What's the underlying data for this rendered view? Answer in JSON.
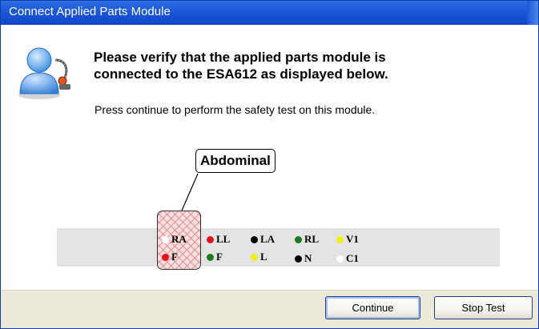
{
  "window": {
    "title": "Connect Applied Parts Module",
    "icon": "user-cable-icon"
  },
  "message": {
    "headline_line1": "Please verify that the applied parts module is",
    "headline_line2": "connected to the ESA612 as displayed below.",
    "instruction": "Press continue to perform the safety test on this module."
  },
  "diagram": {
    "callout_label": "Abdominal",
    "leads": [
      {
        "label": "RA",
        "color": "#ffffff"
      },
      {
        "label": "F",
        "color": "#e0141e"
      },
      {
        "label": "LL",
        "color": "#e0141e"
      },
      {
        "label": "F",
        "color": "#1e7a1e"
      },
      {
        "label": "LA",
        "color": "#000000"
      },
      {
        "label": "L",
        "color": "#f2ef14"
      },
      {
        "label": "RL",
        "color": "#1e7a1e"
      },
      {
        "label": "N",
        "color": "#000000"
      },
      {
        "label": "V1",
        "color": "#f2ef14"
      },
      {
        "label": "C1",
        "color": "#ffffff"
      }
    ]
  },
  "buttons": {
    "continue": "Continue",
    "stop_test": "Stop Test"
  },
  "colors": {
    "titlebar": "#1b57d8",
    "footer": "#ece9d8",
    "strip": "#e3e3e3"
  }
}
